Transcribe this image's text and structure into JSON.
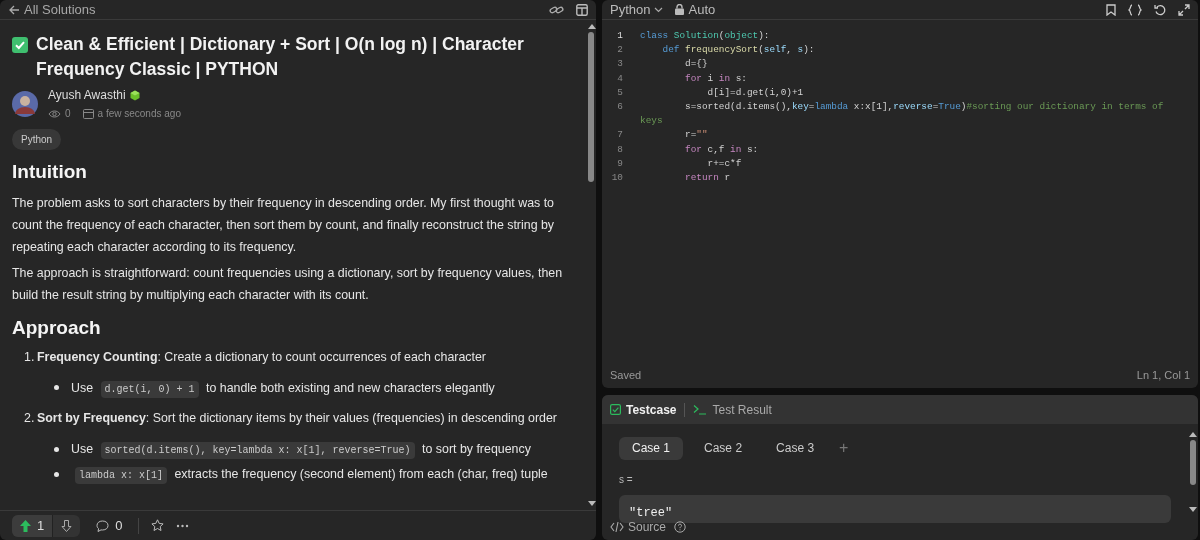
{
  "solution_header": {
    "back_label": "All Solutions"
  },
  "post": {
    "title": "Clean & Efficient | Dictionary + Sort | O(n log n) | Character Frequency Classic | PYTHON",
    "author": "Ayush Awasthi",
    "views": "0",
    "time": "a few seconds ago",
    "tags": [
      "Python"
    ],
    "sections": [
      {
        "kind": "heading",
        "text": "Intuition"
      },
      {
        "kind": "paragraph",
        "text": "The problem asks to sort characters by their frequency in descending order. My first thought was to count the frequency of each character, then sort them by count, and finally reconstruct the string by repeating each character according to its frequency."
      },
      {
        "kind": "paragraph",
        "text": "The approach is straightforward: count frequencies using a dictionary, sort by frequency values, then build the result string by multiplying each character with its count."
      },
      {
        "kind": "heading",
        "text": "Approach"
      },
      {
        "kind": "numbered",
        "number": "1.",
        "segments": [
          {
            "kind": "bold",
            "text": "Frequency Counting"
          },
          {
            "kind": "text",
            "text": ": Create a dictionary to count occurrences of each character"
          }
        ],
        "bullets": [
          [
            {
              "kind": "text",
              "text": "Use"
            },
            {
              "kind": "code",
              "text": "d.get(i, 0) + 1"
            },
            {
              "kind": "text",
              "text": "to handle both existing and new characters elegantly"
            }
          ]
        ]
      },
      {
        "kind": "numbered",
        "number": "2.",
        "segments": [
          {
            "kind": "bold",
            "text": "Sort by Frequency"
          },
          {
            "kind": "text",
            "text": ": Sort the dictionary items by their values (frequencies) in descending order"
          }
        ],
        "bullets": [
          [
            {
              "kind": "text",
              "text": "Use"
            },
            {
              "kind": "code",
              "text": "sorted(d.items(), key=lambda x: x[1], reverse=True)"
            },
            {
              "kind": "text",
              "text": "to sort by frequency"
            }
          ],
          [
            {
              "kind": "code",
              "text": "lambda x: x[1]"
            },
            {
              "kind": "text",
              "text": "extracts the frequency (second element) from each (char, freq) tuple"
            }
          ]
        ]
      }
    ]
  },
  "actions": {
    "upvotes": "1",
    "upvoted": true,
    "comments": "0"
  },
  "editor": {
    "language": "Python",
    "mode": "Auto",
    "status": "Saved",
    "cursor": "Ln 1, Col 1",
    "lines": [
      {
        "number": "1",
        "tokens": [
          {
            "kind": "keyword",
            "text": "class"
          },
          {
            "kind": "type",
            "text": " Solution"
          },
          {
            "kind": "plain",
            "text": "("
          },
          {
            "kind": "type",
            "text": "object"
          },
          {
            "kind": "plain",
            "text": "):"
          }
        ]
      },
      {
        "number": "2",
        "tokens": [
          {
            "kind": "keyword",
            "text": "    def"
          },
          {
            "kind": "function",
            "text": " frequencySort"
          },
          {
            "kind": "plain",
            "text": "("
          },
          {
            "kind": "param",
            "text": "self"
          },
          {
            "kind": "plain",
            "text": ", "
          },
          {
            "kind": "param",
            "text": "s"
          },
          {
            "kind": "plain",
            "text": "):"
          }
        ]
      },
      {
        "number": "3",
        "tokens": [
          {
            "kind": "plain",
            "text": "        d={}"
          }
        ]
      },
      {
        "number": "4",
        "tokens": [
          {
            "kind": "control",
            "text": "        for"
          },
          {
            "kind": "plain",
            "text": " i "
          },
          {
            "kind": "control",
            "text": "in"
          },
          {
            "kind": "plain",
            "text": " s:"
          }
        ]
      },
      {
        "number": "5",
        "tokens": [
          {
            "kind": "plain",
            "text": "            d[i]=d.get(i,0)+1"
          }
        ]
      },
      {
        "number": "6",
        "tokens": [
          {
            "kind": "plain",
            "text": "        s=sorted(d.items(),"
          },
          {
            "kind": "param",
            "text": "key"
          },
          {
            "kind": "plain",
            "text": "="
          },
          {
            "kind": "keyword",
            "text": "lambda"
          },
          {
            "kind": "plain",
            "text": " x:x[1],"
          },
          {
            "kind": "param",
            "text": "reverse"
          },
          {
            "kind": "plain",
            "text": "="
          },
          {
            "kind": "keyword",
            "text": "True"
          },
          {
            "kind": "plain",
            "text": ")"
          },
          {
            "kind": "comment",
            "text": "#sorting our dictionary in terms of keys"
          }
        ]
      },
      {
        "number": "7",
        "tokens": [
          {
            "kind": "plain",
            "text": "        r="
          },
          {
            "kind": "string",
            "text": "\"\""
          }
        ]
      },
      {
        "number": "8",
        "tokens": [
          {
            "kind": "control",
            "text": "        for"
          },
          {
            "kind": "plain",
            "text": " c,f "
          },
          {
            "kind": "control",
            "text": "in"
          },
          {
            "kind": "plain",
            "text": " s:"
          }
        ]
      },
      {
        "number": "9",
        "tokens": [
          {
            "kind": "plain",
            "text": "            r+=c*f"
          }
        ]
      },
      {
        "number": "10",
        "tokens": [
          {
            "kind": "control",
            "text": "        return"
          },
          {
            "kind": "plain",
            "text": " r"
          }
        ]
      }
    ]
  },
  "console": {
    "tabs": [
      {
        "label": "Testcase",
        "selected": true
      },
      {
        "label": "Test Result",
        "selected": false
      }
    ],
    "cases": [
      {
        "label": "Case 1",
        "selected": true
      },
      {
        "label": "Case 2",
        "selected": false
      },
      {
        "label": "Case 3",
        "selected": false
      }
    ],
    "add_case": "+",
    "input_label": "s =",
    "input_value": "\"tree\"",
    "footer": "Source"
  }
}
